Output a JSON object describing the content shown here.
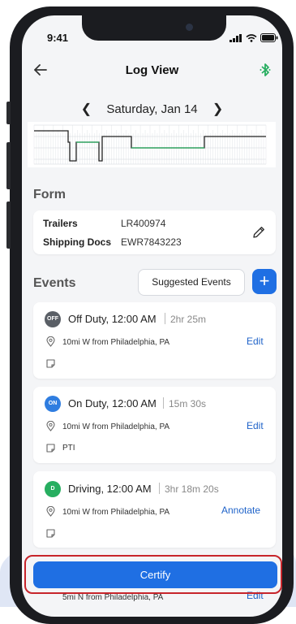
{
  "status_bar": {
    "time": "9:41"
  },
  "header": {
    "title": "Log View",
    "back_icon": "arrow-left-icon",
    "bluetooth_icon": "bluetooth-icon"
  },
  "date_nav": {
    "date": "Saturday, Jan 14"
  },
  "form": {
    "title": "Form",
    "trailers_label": "Trailers",
    "trailers_value": "LR400974",
    "shipping_docs_label": "Shipping Docs",
    "shipping_docs_value": "EWR7843223"
  },
  "events": {
    "title": "Events",
    "suggested_label": "Suggested Events",
    "add_label": "+",
    "items": [
      {
        "badge": "OFF",
        "badge_color": "#5a5f66",
        "title": "Off Duty, 12:00 AM",
        "duration": "2hr 25m",
        "location": "10mi W from Philadelphia, PA",
        "action": "Edit",
        "note": ""
      },
      {
        "badge": "ON",
        "badge_color": "#2f7de0",
        "title": "On Duty, 12:00 AM",
        "duration": "15m 30s",
        "location": "10mi W from Philadelphia, PA",
        "action": "Edit",
        "note": "PTI"
      },
      {
        "badge": "D",
        "badge_color": "#27ae60",
        "title": "Driving, 12:00 AM",
        "duration": "3hr 18m 20s",
        "location": "10mi W from Philadelphia, PA",
        "action": "Annotate",
        "note": ""
      }
    ],
    "partial_location": "5mi N from Philadelphia, PA",
    "partial_action": "Edit"
  },
  "certify": {
    "label": "Certify"
  },
  "colors": {
    "accent": "#1f6fe3",
    "highlight_border": "#c7252b",
    "driving_line": "#27ae60"
  }
}
